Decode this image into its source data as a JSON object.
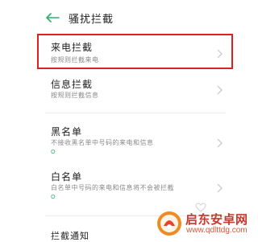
{
  "header": {
    "back_icon": "arrow-left-icon",
    "title": "骚扰拦截",
    "accent_color": "#2fae6b"
  },
  "items": [
    {
      "title": "来电拦截",
      "subtitle": "按规则拦截来电"
    },
    {
      "title": "信息拦截",
      "subtitle": "按规则拦截信息"
    },
    {
      "title": "黑名单",
      "subtitle": "不接收黑名单中号码的来电和信息",
      "tag": "O"
    },
    {
      "title": "白名单",
      "subtitle": "白名单中号码的来电和信息将不会被拦截",
      "tag": "O"
    }
  ],
  "bottom_item": {
    "title": "拦截通知"
  },
  "chevron_icon": "chevron-right-icon",
  "highlight_color": "#e01f1f",
  "watermark": {
    "brand": "启东安卓网",
    "url": "www.qdlttdg.com",
    "logo_icon": "orange-circle-logo-icon"
  }
}
